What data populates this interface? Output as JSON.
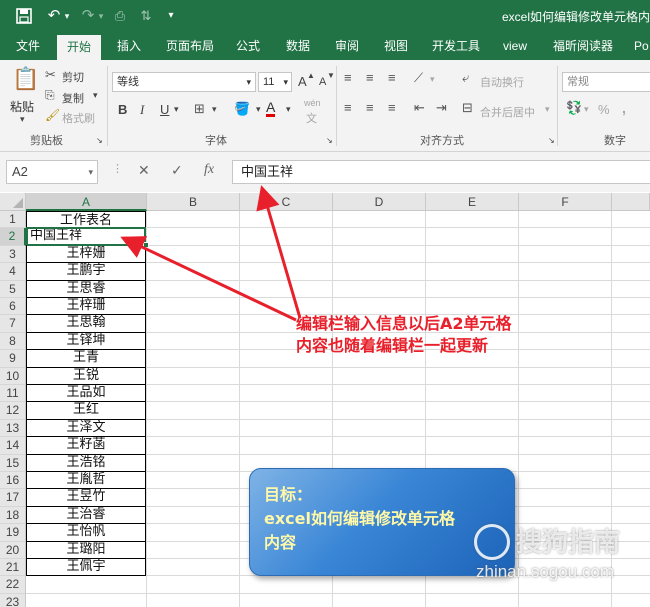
{
  "titlebar": {
    "doc_title": "excel如何编辑修改单元格内",
    "save_icon": "save-icon",
    "undo_icon": "undo-icon",
    "redo_icon": "redo-icon"
  },
  "tabs": [
    "文件",
    "开始",
    "插入",
    "页面布局",
    "公式",
    "数据",
    "审阅",
    "视图",
    "开发工具",
    "view",
    "福昕阅读器",
    "Po"
  ],
  "active_tab": "开始",
  "ribbon": {
    "clipboard": {
      "paste": "粘贴",
      "cut": "剪切",
      "copy": "复制",
      "format_painter": "格式刷",
      "label": "剪贴板"
    },
    "font": {
      "name": "等线",
      "size": "11",
      "grow": "A",
      "shrink": "A",
      "bold": "B",
      "italic": "I",
      "underline": "U",
      "font_color": "A",
      "phonetic": "wén",
      "label": "字体"
    },
    "alignment": {
      "wrap_text": "自动换行",
      "merge_center": "合并后居中",
      "label": "对齐方式"
    },
    "number": {
      "format": "常规",
      "percent": "%",
      "comma": ",",
      "label": "数字"
    }
  },
  "formula_bar": {
    "name_box": "A2",
    "cancel": "✕",
    "enter": "✓",
    "fx": "fx",
    "content": "中国王祥"
  },
  "columns": [
    "A",
    "B",
    "C",
    "D",
    "E",
    "F"
  ],
  "rows": [
    "1",
    "2",
    "3",
    "4",
    "5",
    "6",
    "7",
    "8",
    "9",
    "10",
    "11",
    "12",
    "13",
    "14",
    "15",
    "16",
    "17",
    "18",
    "19",
    "20",
    "21",
    "22",
    "23"
  ],
  "cells": [
    "工作表名",
    "中国王祥",
    "王梓姗",
    "王鹏宇",
    "王思睿",
    "王梓珊",
    "王思翰",
    "王铎坤",
    "王青",
    "王锐",
    "王品如",
    "王红",
    "王泽文",
    "王籽菡",
    "王浩铭",
    "王胤哲",
    "王昱竹",
    "王治睿",
    "王怡帆",
    "王璐阳",
    "王佩宇"
  ],
  "annotation": {
    "line1": "编辑栏输入信息以后A2单元格",
    "line2": "内容也随着编辑栏一起更新"
  },
  "goal": {
    "line1": "目标：",
    "line2": "excel如何编辑修改单元格",
    "line3": "内容"
  },
  "watermark": {
    "text": "搜狗指南",
    "url": "zhinan.sogou.com"
  },
  "colors": {
    "excel_green": "#217346",
    "annotation_red": "#e8202b"
  }
}
